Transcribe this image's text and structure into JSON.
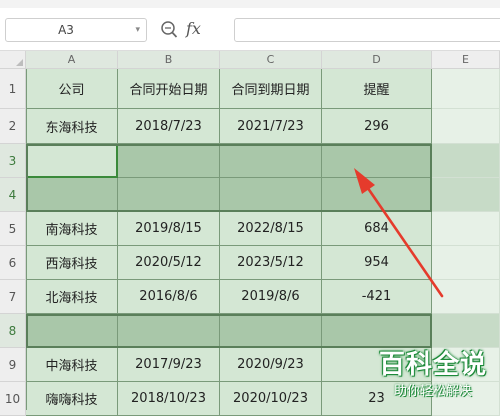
{
  "formula_bar": {
    "name_box": "A3",
    "fx_label": "fx",
    "formula": ""
  },
  "columns": [
    "A",
    "B",
    "C",
    "D",
    "E"
  ],
  "rows": [
    {
      "num": "1",
      "cells": [
        "公司",
        "合同开始日期",
        "合同到期日期",
        "提醒",
        ""
      ]
    },
    {
      "num": "2",
      "cells": [
        "东海科技",
        "2018/7/23",
        "2021/7/23",
        "296",
        ""
      ]
    },
    {
      "num": "3",
      "cells": [
        "",
        "",
        "",
        "",
        ""
      ]
    },
    {
      "num": "4",
      "cells": [
        "",
        "",
        "",
        "",
        ""
      ]
    },
    {
      "num": "5",
      "cells": [
        "南海科技",
        "2019/8/15",
        "2022/8/15",
        "684",
        ""
      ]
    },
    {
      "num": "6",
      "cells": [
        "西海科技",
        "2020/5/12",
        "2023/5/12",
        "954",
        ""
      ]
    },
    {
      "num": "7",
      "cells": [
        "北海科技",
        "2016/8/6",
        "2019/8/6",
        "-421",
        ""
      ]
    },
    {
      "num": "8",
      "cells": [
        "",
        "",
        "",
        "",
        ""
      ]
    },
    {
      "num": "9",
      "cells": [
        "中海科技",
        "2017/9/23",
        "2020/9/23",
        "",
        ""
      ]
    },
    {
      "num": "10",
      "cells": [
        "嗨嗨科技",
        "2018/10/23",
        "2020/10/23",
        "23",
        ""
      ]
    }
  ],
  "selection": {
    "active_cell": "A3",
    "selected_rows": [
      "3",
      "4",
      "8"
    ]
  },
  "colors": {
    "cell_fill": "#d4e7d4",
    "selected_fill": "#a9c7a9",
    "arrow": "#e53b2c",
    "watermark": "#1e8a3a"
  },
  "watermark": {
    "line1": "百科全说",
    "line2": "助你轻松解决"
  }
}
